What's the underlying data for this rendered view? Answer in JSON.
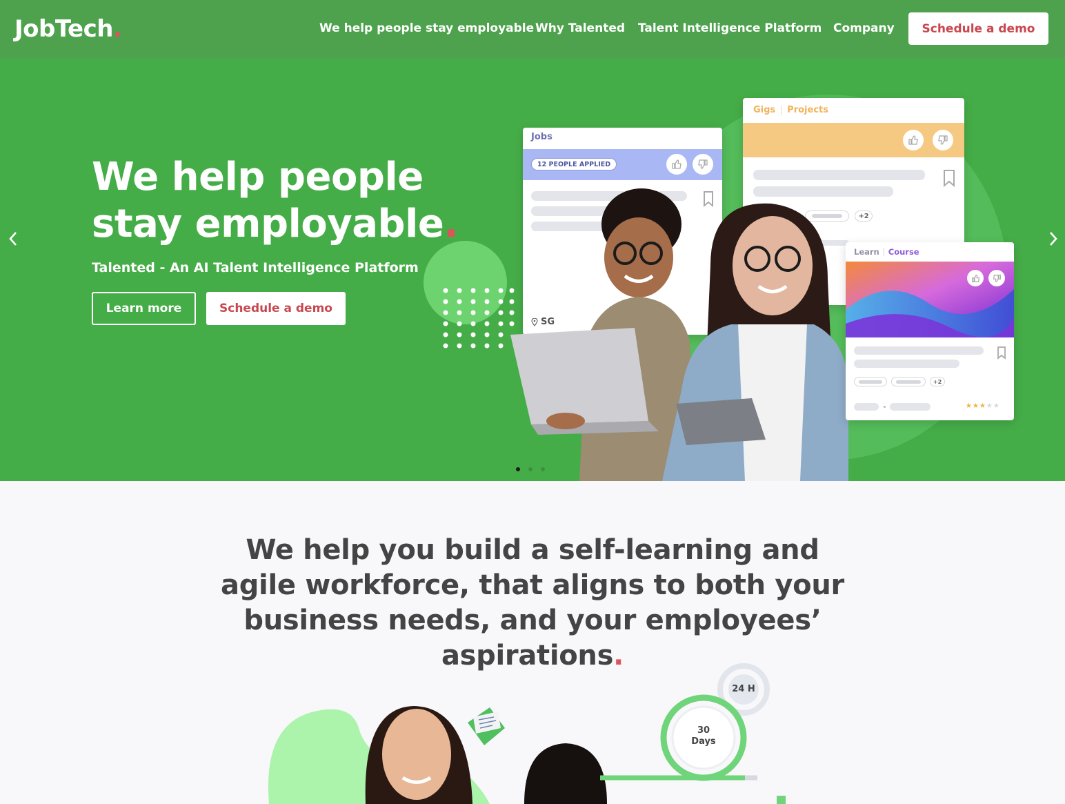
{
  "header": {
    "logo": "JobTech",
    "logo_dot": ".",
    "nav": [
      "We help people stay employable",
      "Why Talented",
      "Talent Intelligence Platform",
      "Company"
    ],
    "cta": "Schedule a demo"
  },
  "hero": {
    "title": "We help people stay employable",
    "title_dot": ".",
    "subtitle": "Talented - An AI Talent Intelligence Platform",
    "learn_more": "Learn more",
    "schedule_demo": "Schedule a demo",
    "prev_icon": "chevron-left-icon",
    "next_icon": "chevron-right-icon",
    "slides_count": 3,
    "active_slide": 1
  },
  "cards": {
    "jobs": {
      "tab": "Jobs",
      "badge": "12 PEOPLE APPLIED",
      "location": "SG"
    },
    "gigs": {
      "tab1": "Gigs",
      "tab2": "Projects",
      "pill": "+2"
    },
    "learn": {
      "tab1": "Learn",
      "tab2": "Course",
      "pill": "+2",
      "rating": 3,
      "rating_max": 5
    }
  },
  "section": {
    "title": "We help you build a self-learning and agile workforce, that aligns to both your business needs, and your employees’ aspirations",
    "title_dot": "."
  },
  "timers": {
    "small": "24 H",
    "large_value": "30",
    "large_unit": "Days"
  },
  "colors": {
    "header_bg": "#4ea24e",
    "hero_bg": "#45ad48",
    "accent_red": "#c9464f",
    "timer_green": "#6fd47a"
  }
}
